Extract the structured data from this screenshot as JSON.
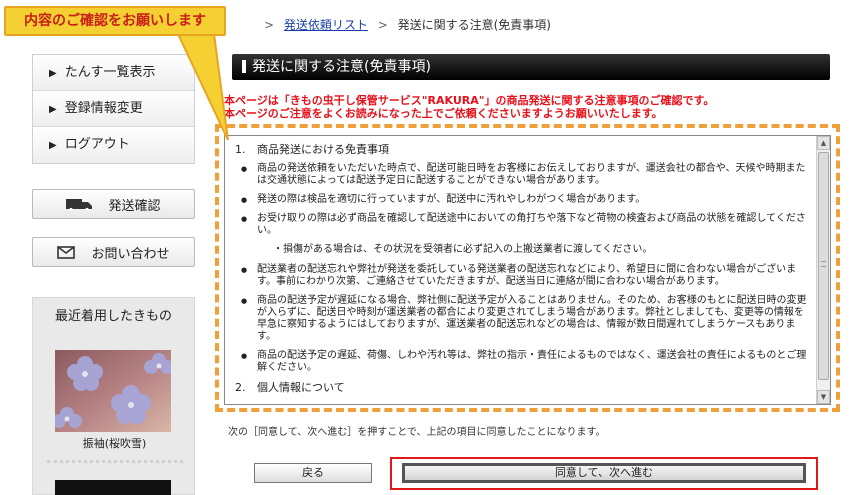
{
  "callout": {
    "text": "内容のご確認をお願いします"
  },
  "breadcrumb": {
    "sep1": ">",
    "link": "発送依頼リスト",
    "sep2": ">",
    "current": "発送に関する注意(免責事項)"
  },
  "sidebar": {
    "menu": [
      {
        "label": "たんす一覧表示"
      },
      {
        "label": "登録情報変更"
      },
      {
        "label": "ログアウト"
      }
    ],
    "ship_button": "発送確認",
    "contact_button": "お問い合わせ",
    "recent_title": "最近着用したきもの",
    "recent_caption": "振袖(桜吹雪)"
  },
  "main": {
    "title": "発送に関する注意(免責事項)",
    "notice_line1": "本ページは「きもの虫干し保管サービス\"RAKURA\"」の商品発送に関する注意事項のご確認です。",
    "notice_line2": "本ページのご注意をよくお読みになった上でご依頼くださいますようお願いいたします。",
    "section1": {
      "num": "1.",
      "title": "商品発送における免責事項"
    },
    "bullets": [
      "商品の発送依頼をいただいた時点で、配送可能日時をお客様にお伝えしておりますが、運送会社の都合や、天候や時期または交通状態によっては配送予定日に配送することができない場合があります。",
      "発送の際は検品を適切に行っていますが、配送中に汚れやしわがつく場合があります。",
      "お受け取りの際は必ず商品を確認して配送途中においての角打ちや落下など荷物の検査および商品の状態を確認してください。"
    ],
    "sub_note": "・損傷がある場合は、その状況を受領者に必ず記入の上搬送業者に渡してください。",
    "bullets2": [
      "配送業者の配送忘れや弊社が発送を委託している発送業者の配送忘れなどにより、希望日に間に合わない場合がございます。事前にわかり次第、ご連絡させていただきますが、配送当日に連絡が間に合わない場合があります。",
      "商品の配送予定が遅延になる場合、弊社側に配送予定が入ることはありません。そのため、お客様のもとに配送日時の変更が入らずに、配送日や時刻が運送業者の都合により変更されてしまう場合があります。弊社としましても、変更等の情報を早急に察知するようにはしておりますが、運送業者の配送忘れなどの場合は、情報が数日間遅れてしまうケースもあります。",
      "商品の配送予定の遅延、荷傷、しわや汚れ等は、弊社の指示・責任によるものではなく、運送会社の責任によるものとご理解ください。"
    ],
    "section2": {
      "num": "2.",
      "title": "個人情報について"
    },
    "agree_note": "次の［同意して、次へ進む］を押すことで、上記の項目に同意したことになります。",
    "back_button": "戻る",
    "next_button": "同意して、次へ進む"
  },
  "colors": {
    "callout_bg": "#f5d033",
    "highlight_orange": "#f0a03a",
    "highlight_red": "#e01818",
    "notice_red": "#e8101a",
    "link_blue": "#1a3fa8"
  }
}
